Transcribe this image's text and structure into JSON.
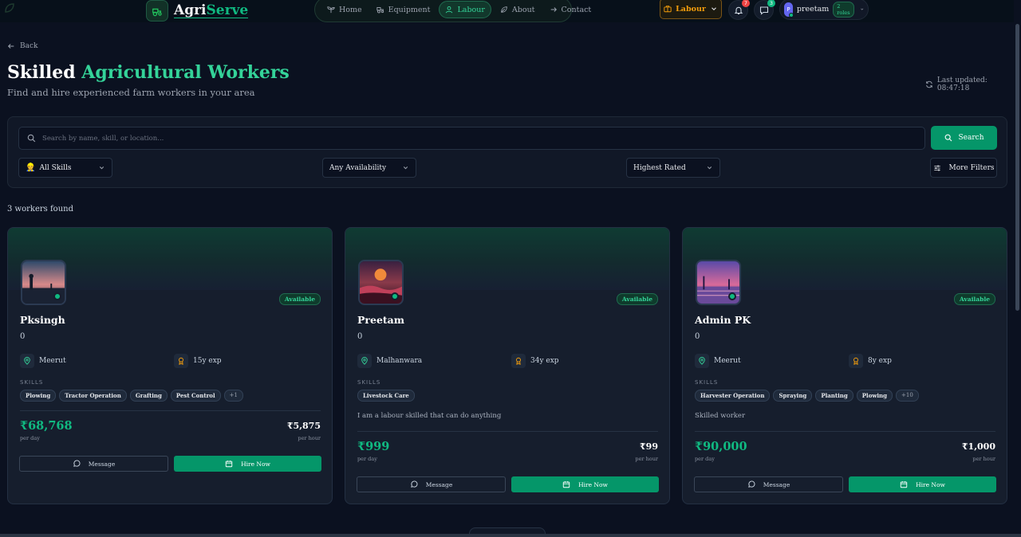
{
  "header": {
    "brand_prefix": "Agri",
    "brand_highlight": "Serve",
    "nav": [
      {
        "label": "Home",
        "icon": "sprout-icon"
      },
      {
        "label": "Equipment",
        "icon": "tractor-icon"
      },
      {
        "label": "Labour",
        "icon": "user-icon",
        "active": true
      },
      {
        "label": "About",
        "icon": "leaf-icon"
      },
      {
        "label": "Contact",
        "icon": "arrow-icon"
      }
    ],
    "role_switch": "Labour",
    "notifications_count": "7",
    "messages_count": "3",
    "user": {
      "initial": "P",
      "name": "preetam",
      "roles": "2 roles"
    }
  },
  "page": {
    "back_label": "Back",
    "title_prefix": "Skilled ",
    "title_highlight": "Agricultural Workers",
    "subtitle": "Find and hire experienced farm workers in your area",
    "last_updated": "Last updated: 08:47:18"
  },
  "filters": {
    "search_placeholder": "Search by name, skill, or location...",
    "search_button": "Search",
    "skills_select": "All Skills",
    "availability_select": "Any Availability",
    "sort_select": "Highest Rated",
    "more_filters": "More Filters"
  },
  "results": {
    "count_text": "3 workers found",
    "skills_label": "SKILLS",
    "message_label": "Message",
    "hire_label": "Hire Now",
    "per_day_label": "per day",
    "per_hour_label": "per hour",
    "workers": [
      {
        "name": "Pksingh",
        "rating": "0",
        "status": "Available",
        "location": "Meerut",
        "experience": "15y exp",
        "skills": [
          "Plowing",
          "Tractor Operation",
          "Grafting",
          "Pest Control"
        ],
        "more_skills": "+1",
        "bio": "",
        "day_rate": "₹68,768",
        "hour_rate": "₹5,875"
      },
      {
        "name": "Preetam",
        "rating": "0",
        "status": "Available",
        "location": "Malhanwara",
        "experience": "34y exp",
        "skills": [
          "Livestock Care"
        ],
        "more_skills": "",
        "bio": "I am a labour skilled that can do anything",
        "day_rate": "₹999",
        "hour_rate": "₹99"
      },
      {
        "name": "Admin PK",
        "rating": "0",
        "status": "Available",
        "location": "Meerut",
        "experience": "8y exp",
        "skills": [
          "Harvester Operation",
          "Spraying",
          "Planting",
          "Plowing"
        ],
        "more_skills": "+10",
        "bio": "Skilled worker",
        "day_rate": "₹90,000",
        "hour_rate": "₹1,000"
      }
    ]
  },
  "colors": {
    "background": "#0b1120",
    "accent": "#10b981",
    "labour_accent": "#f59e0b",
    "card": "#161e2d"
  }
}
